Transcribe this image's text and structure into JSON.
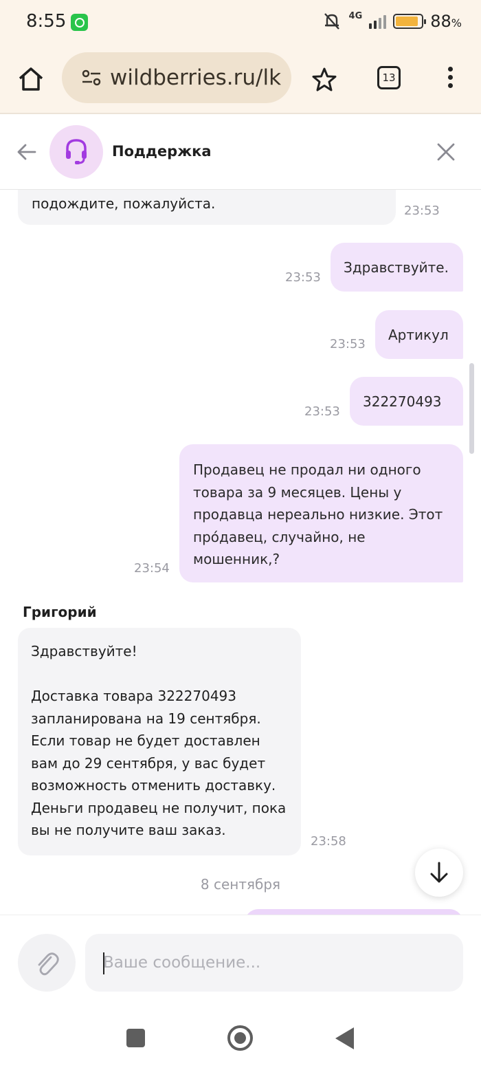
{
  "status_bar": {
    "time": "8:55",
    "network": "4G",
    "battery_percent": "88",
    "battery_unit": "%",
    "battery_level": 0.88
  },
  "browser": {
    "url": "wildberries.ru/lk",
    "tab_count": "13"
  },
  "chat": {
    "title": "Поддержка",
    "input_placeholder": "Ваше сообщение...",
    "messages": [
      {
        "direction": "incoming",
        "text": "подождите, пожалуйста.",
        "time": "23:53"
      },
      {
        "direction": "outgoing",
        "text": "Здравствуйте.",
        "time": "23:53"
      },
      {
        "direction": "outgoing",
        "text": "Артикул",
        "time": "23:53"
      },
      {
        "direction": "outgoing",
        "text": "322270493",
        "time": "23:53"
      },
      {
        "direction": "outgoing",
        "lines": [
          "Продавец не продал ни одного",
          "товара за 9 месяцев. Цены у",
          "продавца нереально низкие. Этот",
          "про́давец, случайно, не",
          "мошенник,?"
        ],
        "time": "23:54"
      },
      {
        "direction": "incoming",
        "sender": "Григорий",
        "lines": [
          "Здравствуйте!",
          "",
          "Доставка товара 322270493",
          "запланирована на 19 сентября.",
          "Если товар не будет доставлен",
          "вам до 29 сентября, у вас будет",
          "возможность отменить доставку.",
          "Деньги продавец не получит, пока",
          "вы не получите ваш заказ."
        ],
        "time": "23:58"
      }
    ],
    "date_separator": "8 сентября"
  },
  "colors": {
    "accent": "#a23be0",
    "outgoing_bubble": "#f2e4fb",
    "incoming_bubble": "#f4f4f6",
    "browser_bar": "#fcf4ea"
  }
}
